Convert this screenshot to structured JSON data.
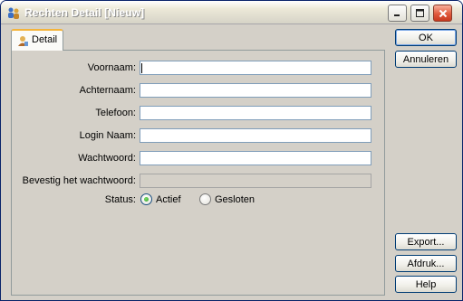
{
  "window": {
    "title": "Rechten Detail [Nieuw]"
  },
  "tab": {
    "label": "Detail"
  },
  "form": {
    "fields": [
      {
        "label": "Voornaam:",
        "value": ""
      },
      {
        "label": "Achternaam:",
        "value": ""
      },
      {
        "label": "Telefoon:",
        "value": ""
      },
      {
        "label": "Login Naam:",
        "value": ""
      },
      {
        "label": "Wachtwoord:",
        "value": ""
      },
      {
        "label": "Bevestig het wachtwoord:",
        "value": ""
      }
    ],
    "status": {
      "label": "Status:",
      "options": [
        "Actief",
        "Gesloten"
      ],
      "selected": "Actief"
    }
  },
  "buttons": {
    "ok": "OK",
    "cancel": "Annuleren",
    "export": "Export...",
    "print": "Afdruk...",
    "help": "Help"
  },
  "colors": {
    "dialog_bg": "#d4d0c8",
    "field_border": "#7f9db9",
    "tab_accent": "#f4b43a",
    "button_border": "#003c74"
  }
}
